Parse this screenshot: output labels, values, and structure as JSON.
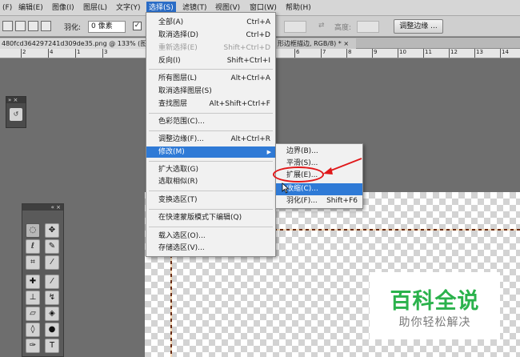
{
  "menubar": {
    "items": [
      {
        "label": "(F)"
      },
      {
        "label": "编辑(E)"
      },
      {
        "label": "图像(I)"
      },
      {
        "label": "图层(L)"
      },
      {
        "label": "文字(Y)"
      },
      {
        "label": "选择(S)"
      },
      {
        "label": "滤镜(T)"
      },
      {
        "label": "视图(V)"
      },
      {
        "label": "窗口(W)"
      },
      {
        "label": "帮助(H)"
      }
    ]
  },
  "options": {
    "feather_label": "羽化:",
    "feather_value": "0 像素",
    "height_label": "高度:",
    "refine_edge_button": "调整边缘 ..."
  },
  "tabs": {
    "doc1": "480fcd364297241d309de35.png @ 133% (图",
    "doc2": "形边框描边, RGB/8) * ×"
  },
  "ruler": {
    "left_numbers": [
      "2",
      "4",
      "1",
      "3"
    ],
    "right_numbers": [
      "6",
      "7",
      "8",
      "9",
      "10",
      "11",
      "12",
      "13",
      "14"
    ]
  },
  "select_menu": {
    "items": [
      {
        "label": "全部(A)",
        "shortcut": "Ctrl+A"
      },
      {
        "label": "取消选择(D)",
        "shortcut": "Ctrl+D"
      },
      {
        "label": "重新选择(E)",
        "shortcut": "Shift+Ctrl+D"
      },
      {
        "label": "反向(I)",
        "shortcut": "Shift+Ctrl+I"
      },
      {
        "label": "所有图层(L)",
        "shortcut": "Alt+Ctrl+A"
      },
      {
        "label": "取消选择图层(S)",
        "shortcut": ""
      },
      {
        "label": "查找图层",
        "shortcut": "Alt+Shift+Ctrl+F"
      },
      {
        "label": "色彩范围(C)...",
        "shortcut": ""
      },
      {
        "label": "调整边缘(F)...",
        "shortcut": "Alt+Ctrl+R"
      },
      {
        "label": "修改(M)",
        "shortcut": ""
      },
      {
        "label": "扩大选取(G)",
        "shortcut": ""
      },
      {
        "label": "选取相似(R)",
        "shortcut": ""
      },
      {
        "label": "变换选区(T)",
        "shortcut": ""
      },
      {
        "label": "在快速蒙版模式下编辑(Q)",
        "shortcut": ""
      },
      {
        "label": "载入选区(O)...",
        "shortcut": ""
      },
      {
        "label": "存储选区(V)...",
        "shortcut": ""
      }
    ]
  },
  "modify_submenu": {
    "items": [
      {
        "label": "边界(B)...",
        "shortcut": ""
      },
      {
        "label": "平滑(S)...",
        "shortcut": ""
      },
      {
        "label": "扩展(E)...",
        "shortcut": ""
      },
      {
        "label": "收缩(C)...",
        "shortcut": ""
      },
      {
        "label": "羽化(F)...",
        "shortcut": "Shift+F6"
      }
    ]
  },
  "watermark": {
    "title": "百科全说",
    "subtitle": "助你轻松解决"
  },
  "colors": {
    "highlight": "#2f7ad6",
    "annotation_red": "#e0181a",
    "watermark_green": "#2bb24c"
  }
}
